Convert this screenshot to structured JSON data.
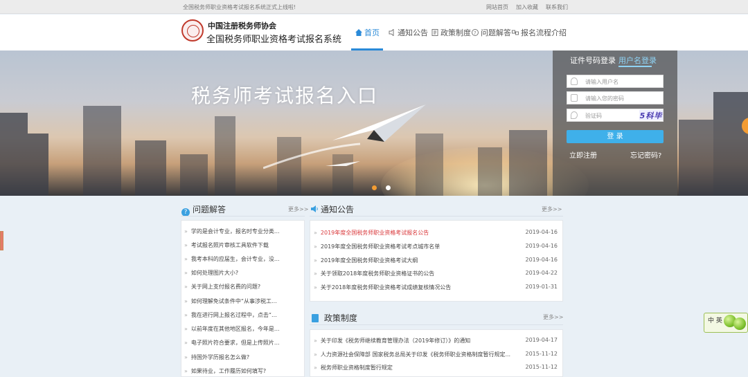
{
  "topbar": {
    "notice": "全国税务师职业资格考试报名系统正式上线啦!",
    "links": [
      "网站首页",
      "加入收藏",
      "联系我们"
    ]
  },
  "header": {
    "logo_script": "中国注册税务师协会",
    "logo_name": "全国税务师职业资格考试报名系统"
  },
  "nav": {
    "items": [
      "首页",
      "通知公告",
      "政策制度",
      "问题解答",
      "报名流程介绍"
    ],
    "active_color": "#2a8ad8"
  },
  "banner": {
    "title": "税务师考试报名入口",
    "active_dot_color": "#f39c33",
    "dot_color": "#ffffff"
  },
  "login": {
    "tabs": [
      "证件号码登录",
      "用户名登录"
    ],
    "username_placeholder": "请输入用户名",
    "password_placeholder": "请输入您的密码",
    "captcha_placeholder": "验证码",
    "captcha_text": "5科毕",
    "button": "登 录",
    "register": "立即注册",
    "forgot": "忘记密码?",
    "button_color": "#3fb0ea"
  },
  "qa": {
    "title": "问题解答",
    "more": "更多>>",
    "items": [
      "学的是会计专业，报名时专业分类...",
      "考试报名照片审核工具软件下载",
      "我考本科的应届生，会计专业，没...",
      "如何处理图片大小?",
      "关于网上支付报名费的问题?",
      "如何理解免试条件中“从事涉税工...",
      "我在进行网上报名过程中，点击“...",
      "以前年度在其他地区报名，今年是...",
      "电子照片符合要求，但是上传照片...",
      "持国外学历报名怎么做?",
      "如果待业，工作履历如何填写?"
    ]
  },
  "notices": {
    "title": "通知公告",
    "more": "更多>>",
    "items": [
      {
        "text": "2019年度全国税务师职业资格考试报名公告",
        "date": "2019-04-16",
        "hot": true
      },
      {
        "text": "2019年度全国税务师职业资格考试考点城市名单",
        "date": "2019-04-16",
        "hot": false
      },
      {
        "text": "2019年度全国税务师职业资格考试大纲",
        "date": "2019-04-16",
        "hot": false
      },
      {
        "text": "关于领取2018年度税务师职业资格证书的公告",
        "date": "2019-04-22",
        "hot": false
      },
      {
        "text": "关于2018年度税务师职业资格考试成绩复核情况公告",
        "date": "2019-01-31",
        "hot": false
      }
    ]
  },
  "policy": {
    "title": "政策制度",
    "more": "更多>>",
    "items": [
      {
        "text": "关于印发《税务师继续教育管理办法（2019年修订）》的通知",
        "date": "2019-04-17"
      },
      {
        "text": "人力资源社会保障部 国家税务总局关于印发《税务师职业资格制度暂行规定...",
        "date": "2015-11-12"
      },
      {
        "text": "税务师职业资格制度暂行规定",
        "date": "2015-11-12"
      }
    ]
  },
  "widget": {
    "text": "中 英"
  }
}
